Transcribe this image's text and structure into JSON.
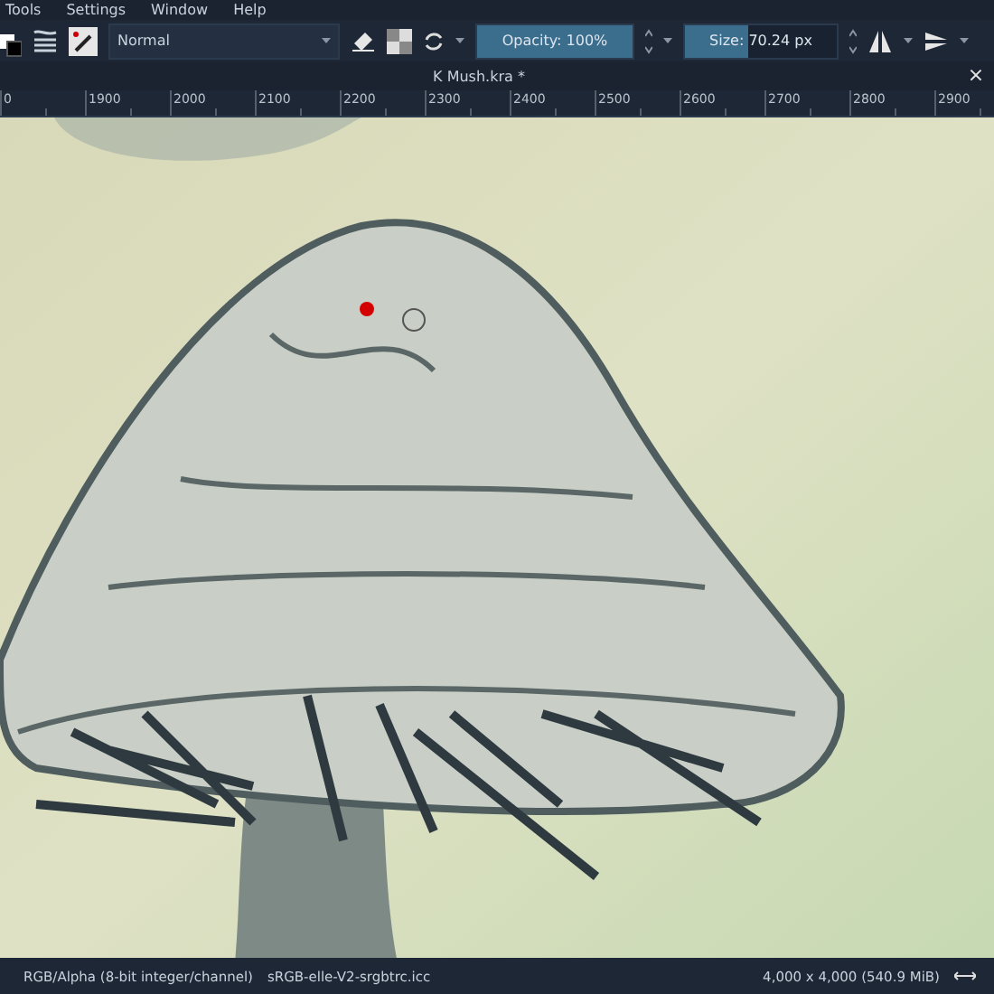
{
  "menu": [
    "Tools",
    "Settings",
    "Window",
    "Help"
  ],
  "toolbar": {
    "blend_mode": "Normal",
    "opacity": {
      "label": "Opacity: 100%",
      "level": 1.0
    },
    "size": {
      "label": "Size: 70.24 px",
      "level": 0.42
    }
  },
  "document_tab": {
    "title": "K Mush.kra *",
    "close": "×"
  },
  "ruler": [
    "0",
    "1900",
    "2000",
    "2100",
    "2200",
    "2300",
    "2400",
    "2500",
    "2600",
    "2700",
    "2800",
    "2900"
  ],
  "status_bar": {
    "color_model": "RGB/Alpha (8-bit integer/channel)",
    "profile": "sRGB-elle-V2-srgbtrc.icc",
    "dimensions": "4,000 x 4,000 (540.9 MiB)"
  }
}
